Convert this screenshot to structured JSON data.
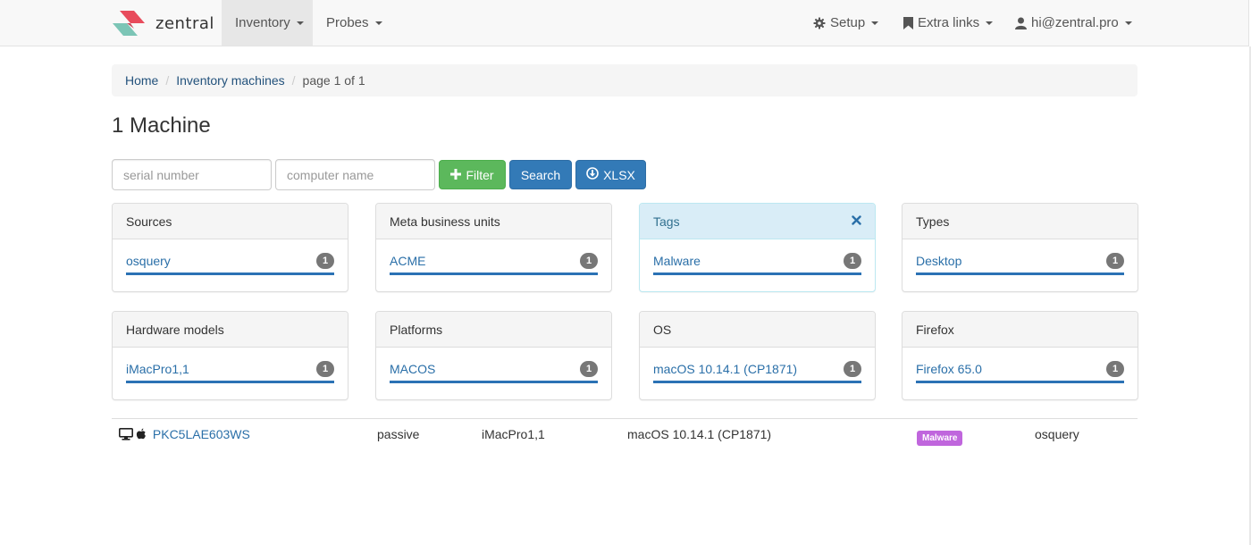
{
  "brand": {
    "name": "zentral",
    "logo_colors": [
      "#e84b5c",
      "#7cc5b6"
    ]
  },
  "navbar": {
    "inventory": "Inventory",
    "probes": "Probes",
    "setup": "Setup",
    "extra_links": "Extra links",
    "user": "hi@zentral.pro"
  },
  "breadcrumb": {
    "home": "Home",
    "section": "Inventory machines",
    "current": "page 1 of 1"
  },
  "page": {
    "title": "1 Machine"
  },
  "filter_form": {
    "serial_placeholder": "serial number",
    "name_placeholder": "computer name",
    "filter_label": "Filter",
    "search_label": "Search",
    "xlsx_label": "XLSX"
  },
  "panels": [
    {
      "title": "Sources",
      "item": "osquery",
      "count": "1",
      "style": "default"
    },
    {
      "title": "Meta business units",
      "item": "ACME",
      "count": "1",
      "style": "default"
    },
    {
      "title": "Tags",
      "item": "Malware",
      "count": "1",
      "style": "info"
    },
    {
      "title": "Types",
      "item": "Desktop",
      "count": "1",
      "style": "default"
    },
    {
      "title": "Hardware models",
      "item": "iMacPro1,1",
      "count": "1",
      "style": "default"
    },
    {
      "title": "Platforms",
      "item": "MACOS",
      "count": "1",
      "style": "default"
    },
    {
      "title": "OS",
      "item": "macOS 10.14.1 (CP1871)",
      "count": "1",
      "style": "default"
    },
    {
      "title": "Firefox",
      "item": "Firefox 65.0",
      "count": "1",
      "style": "default"
    }
  ],
  "machines": [
    {
      "serial": "PKC5LAE603WS",
      "status": "passive",
      "model": "iMacPro1,1",
      "os": "macOS 10.14.1 (CP1871)",
      "tag": "Malware",
      "source": "osquery"
    }
  ],
  "colors": {
    "link": "#2a6fa8",
    "success": "#5cb85c",
    "primary": "#337ab7",
    "tag_malware": "#c066dd",
    "badge": "#777777"
  }
}
